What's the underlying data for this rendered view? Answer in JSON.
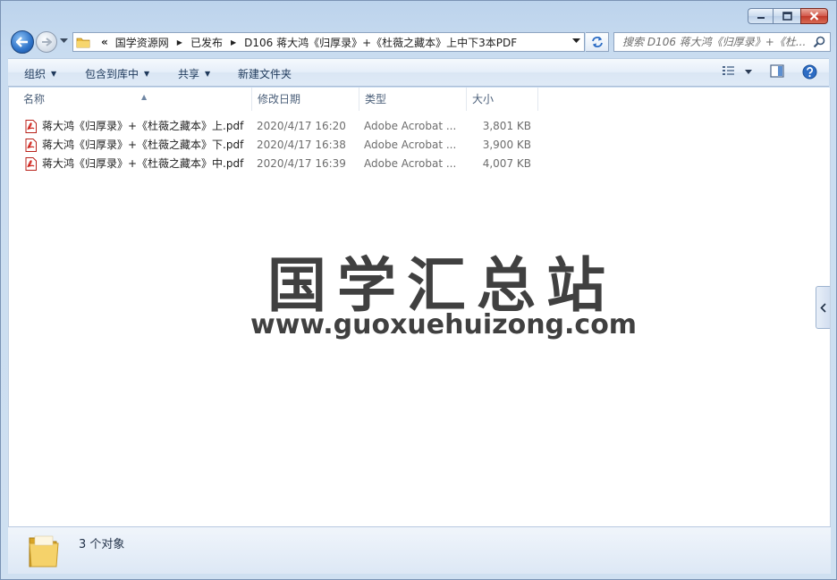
{
  "window": {
    "caption_buttons": [
      "minimize",
      "maximize",
      "close"
    ]
  },
  "address": {
    "chevron": "«",
    "segments": [
      "国学资源网",
      "已发布",
      "D106 蒋大鸿《归厚录》+《杜薇之藏本》上中下3本PDF"
    ]
  },
  "search": {
    "placeholder": "搜索 D106 蒋大鸿《归厚录》+《杜..."
  },
  "toolbar": {
    "organize": "组织",
    "include_in_library": "包含到库中",
    "share": "共享",
    "new_folder": "新建文件夹"
  },
  "columns": {
    "name": "名称",
    "date": "修改日期",
    "type": "类型",
    "size": "大小"
  },
  "files": [
    {
      "name": "蒋大鸿《归厚录》+《杜薇之藏本》上.pdf",
      "date": "2020/4/17 16:20",
      "type": "Adobe Acrobat ...",
      "size": "3,801 KB"
    },
    {
      "name": "蒋大鸿《归厚录》+《杜薇之藏本》下.pdf",
      "date": "2020/4/17 16:38",
      "type": "Adobe Acrobat ...",
      "size": "3,900 KB"
    },
    {
      "name": "蒋大鸿《归厚录》+《杜薇之藏本》中.pdf",
      "date": "2020/4/17 16:39",
      "type": "Adobe Acrobat ...",
      "size": "4,007 KB"
    }
  ],
  "watermark": {
    "title": "国学汇总站",
    "url": "www.guoxuehuizong.com"
  },
  "status": {
    "count_text": "3 个对象"
  },
  "colors": {
    "accent": "#2d72c8",
    "close_red": "#c1392b",
    "pdf_red": "#d0231b",
    "folder_yellow": "#f2c94c"
  }
}
